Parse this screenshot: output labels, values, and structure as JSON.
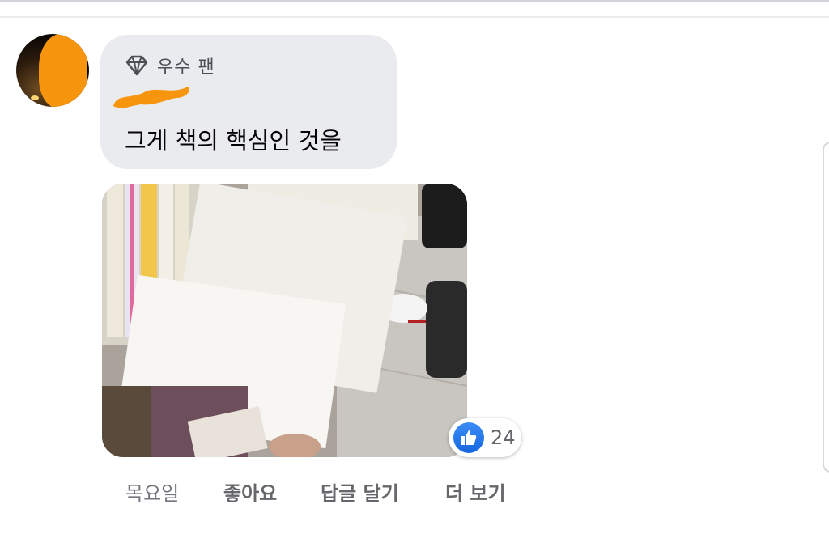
{
  "comment": {
    "badge_label": "우수 팬",
    "author_name": "",
    "text": "그게 책의 핵심인 것을",
    "attached_photo": "photo",
    "reactions": {
      "type": "like",
      "count": "24"
    }
  },
  "actions": {
    "timestamp": "목요일",
    "like_label": "좋아요",
    "reply_label": "답글 달기",
    "more_label": "더 보기"
  },
  "colors": {
    "bubble": "#eaebef",
    "redaction": "#f7960e",
    "like_blue": "#1877f2",
    "secondary_text": "#65676b"
  }
}
